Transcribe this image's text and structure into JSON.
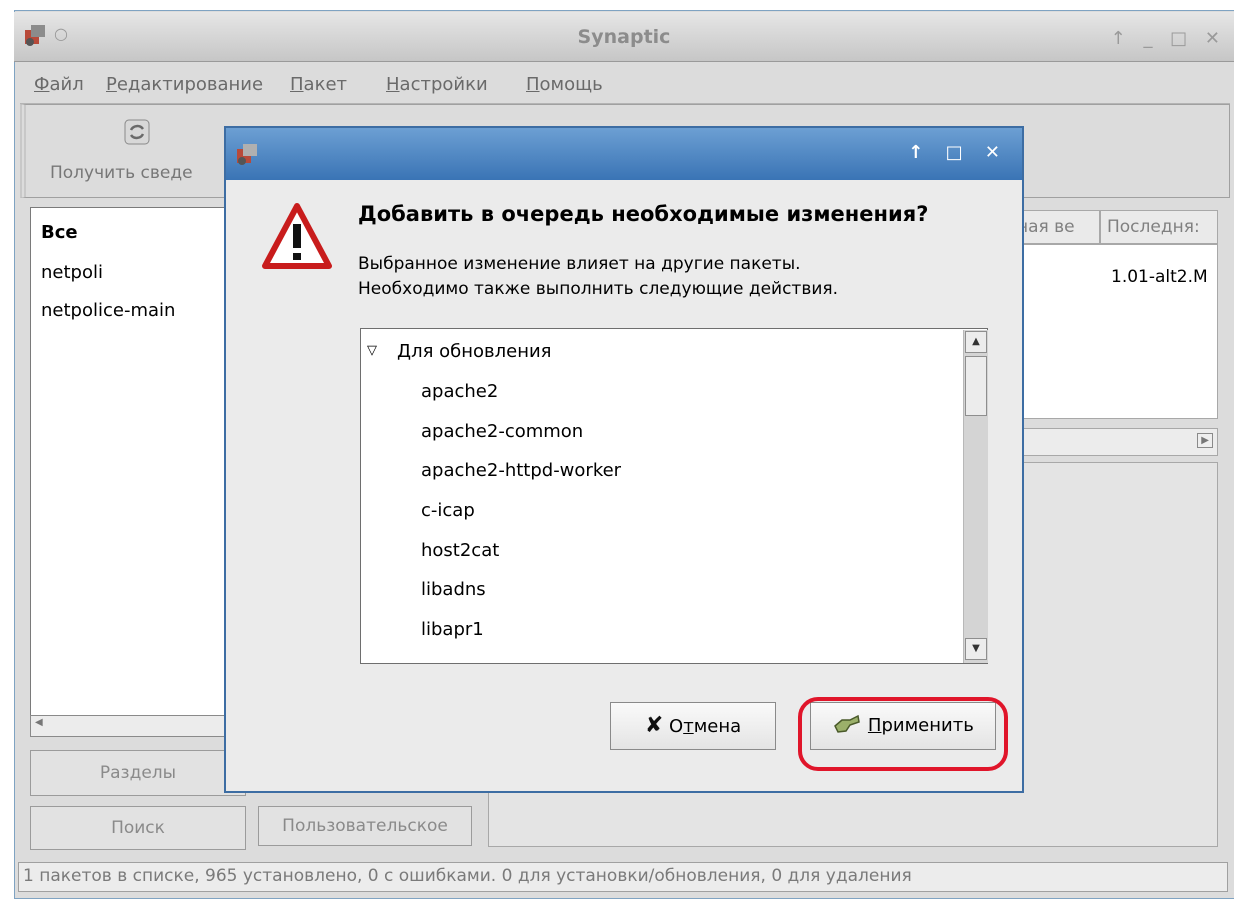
{
  "window": {
    "title": "Synaptic"
  },
  "menu": {
    "items": [
      "Файл",
      "Редактирование",
      "Пакет",
      "Настройки",
      "Помощь"
    ]
  },
  "toolbar": {
    "reload_label": "Получить сведе"
  },
  "filters": {
    "items": [
      "Все",
      "netpoli",
      "netpolice-main"
    ]
  },
  "columns": {
    "installed_version": "ная ве",
    "latest_version": "Последня:"
  },
  "packages": {
    "row1_latest": "1.01-alt2.M"
  },
  "left_buttons": {
    "sections": "Разделы",
    "search": "Поиск",
    "custom": "Пользовательское"
  },
  "dialog": {
    "heading": "Добавить в очередь необходимые изменения?",
    "message_line1": "Выбранное изменение влияет на другие пакеты.",
    "message_line2": "Необходимо также выполнить следующие действия.",
    "group_label": "Для обновления",
    "packages": [
      "apache2",
      "apache2-common",
      "apache2-httpd-worker",
      "c-icap",
      "host2cat",
      "libadns",
      "libapr1"
    ],
    "cancel_pre": "О",
    "cancel_u": "т",
    "cancel_post": "мена",
    "apply_u": "П",
    "apply_post": "рименить"
  },
  "status": {
    "text": "1 пакетов в списке, 965 установлено, 0 с ошибками. 0 для установки/обновления, 0 для удаления"
  },
  "colors": {
    "dialog_titlebar": "#3a74b5",
    "highlight": "#e0152a",
    "warning": "#d62020"
  }
}
